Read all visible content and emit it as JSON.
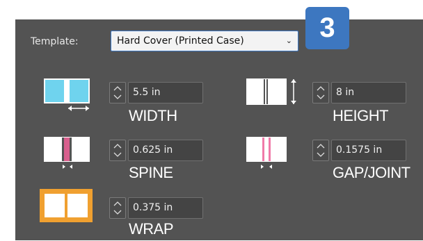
{
  "template": {
    "label": "Template:",
    "selected": "Hard Cover (Printed Case)"
  },
  "badge": "3",
  "fields": {
    "width": {
      "value": "5.5 in",
      "caption": "WIDTH"
    },
    "height": {
      "value": "8 in",
      "caption": "HEIGHT"
    },
    "spine": {
      "value": "0.625 in",
      "caption": "SPINE"
    },
    "gap_joint": {
      "value": "0.1575 in",
      "caption": "GAP/JOINT"
    },
    "wrap": {
      "value": "0.375 in",
      "caption": "WRAP"
    }
  },
  "colors": {
    "panel": "#535353",
    "accent_blue": "#3d77c0",
    "width_icon_fill": "#6fd3ee",
    "spine_icon": "#d8608e",
    "gap_icon": "#f07aa8",
    "wrap_icon": "#f0a030"
  }
}
